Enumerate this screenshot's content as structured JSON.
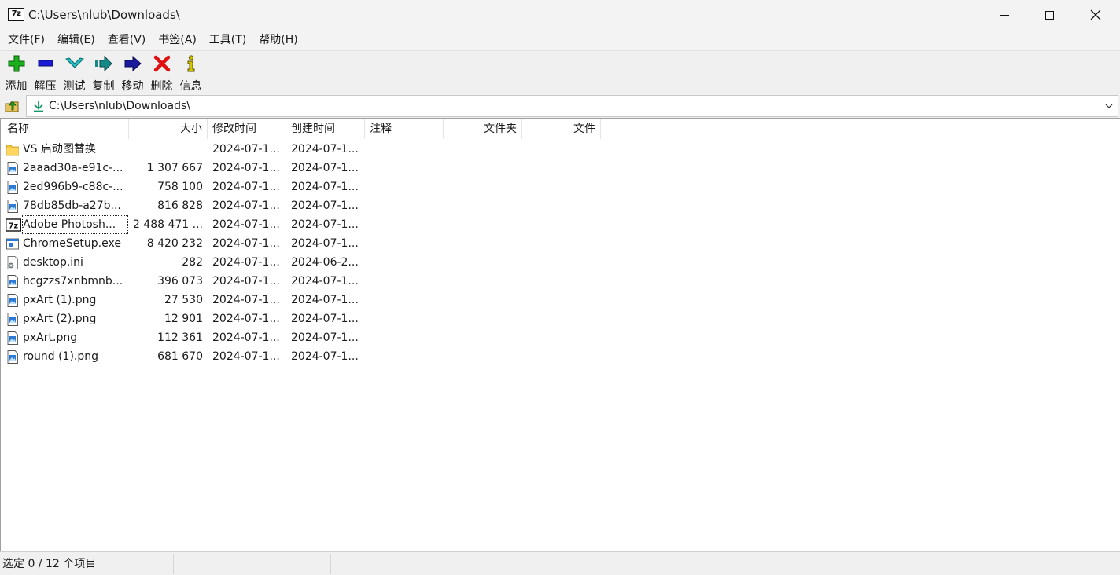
{
  "window": {
    "title": "C:\\Users\\nlub\\Downloads\\",
    "app_icon_text": "7z"
  },
  "menu": [
    {
      "label": "文件(F)"
    },
    {
      "label": "编辑(E)"
    },
    {
      "label": "查看(V)"
    },
    {
      "label": "书签(A)"
    },
    {
      "label": "工具(T)"
    },
    {
      "label": "帮助(H)"
    }
  ],
  "toolbar": [
    {
      "label": "添加",
      "icon": "plus-icon",
      "color": "#1bb01b"
    },
    {
      "label": "解压",
      "icon": "minus-icon",
      "color": "#1a1ad6"
    },
    {
      "label": "测试",
      "icon": "check-chevron-icon",
      "color": "#22c2c2"
    },
    {
      "label": "复制",
      "icon": "copy-arrow-icon",
      "color": "#158a8a"
    },
    {
      "label": "移动",
      "icon": "move-arrow-icon",
      "color": "#1a1a9e"
    },
    {
      "label": "删除",
      "icon": "delete-x-icon",
      "color": "#e01010"
    },
    {
      "label": "信息",
      "icon": "info-icon",
      "color": "#d4c400"
    }
  ],
  "address": {
    "path": "C:\\Users\\nlub\\Downloads\\"
  },
  "columns": {
    "name": "名称",
    "size": "大小",
    "modified": "修改时间",
    "created": "创建时间",
    "comment": "注释",
    "folders": "文件夹",
    "files": "文件"
  },
  "rows": [
    {
      "name": "VS 启动图替换",
      "size": "",
      "modified": "2024-07-1...",
      "created": "2024-07-1...",
      "icon": "folder-icon"
    },
    {
      "name": "2aaad30a-e91c-...",
      "size": "1 307 667",
      "modified": "2024-07-1...",
      "created": "2024-07-1...",
      "icon": "image-file-icon"
    },
    {
      "name": "2ed996b9-c88c-...",
      "size": "758 100",
      "modified": "2024-07-1...",
      "created": "2024-07-1...",
      "icon": "image-file-icon"
    },
    {
      "name": "78db85db-a27b...",
      "size": "816 828",
      "modified": "2024-07-1...",
      "created": "2024-07-1...",
      "icon": "image-file-icon"
    },
    {
      "name": "Adobe Photosh...",
      "size": "2 488 471 ...",
      "modified": "2024-07-1...",
      "created": "2024-07-1...",
      "icon": "7z-archive-icon"
    },
    {
      "name": "ChromeSetup.exe",
      "size": "8 420 232",
      "modified": "2024-07-1...",
      "created": "2024-07-1...",
      "icon": "exe-file-icon"
    },
    {
      "name": "desktop.ini",
      "size": "282",
      "modified": "2024-07-1...",
      "created": "2024-06-2...",
      "icon": "ini-file-icon"
    },
    {
      "name": "hcgzzs7xnbmnb...",
      "size": "396 073",
      "modified": "2024-07-1...",
      "created": "2024-07-1...",
      "icon": "image-file-icon"
    },
    {
      "name": "pxArt (1).png",
      "size": "27 530",
      "modified": "2024-07-1...",
      "created": "2024-07-1...",
      "icon": "image-file-icon"
    },
    {
      "name": "pxArt (2).png",
      "size": "12 901",
      "modified": "2024-07-1...",
      "created": "2024-07-1...",
      "icon": "image-file-icon"
    },
    {
      "name": "pxArt.png",
      "size": "112 361",
      "modified": "2024-07-1...",
      "created": "2024-07-1...",
      "icon": "image-file-icon"
    },
    {
      "name": "round (1).png",
      "size": "681 670",
      "modified": "2024-07-1...",
      "created": "2024-07-1...",
      "icon": "image-file-icon"
    }
  ],
  "status": {
    "selection": "选定 0 / 12 个项目",
    "cell2": "",
    "cell3": "",
    "cell4": ""
  }
}
